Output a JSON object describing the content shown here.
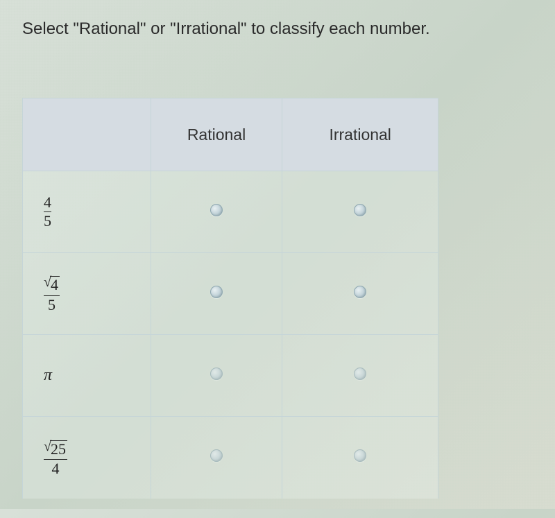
{
  "prompt": "Select \"Rational\" or \"Irrational\" to classify each number.",
  "headers": {
    "col1": "",
    "col2": "Rational",
    "col3": "Irrational"
  },
  "rows": [
    {
      "expression": {
        "type": "fraction",
        "num": "4",
        "den": "5"
      },
      "label": "4/5"
    },
    {
      "expression": {
        "type": "sqrt-fraction",
        "num_sqrt": "4",
        "den": "5"
      },
      "label": "sqrt(4)/5"
    },
    {
      "expression": {
        "type": "pi"
      },
      "label": "pi"
    },
    {
      "expression": {
        "type": "sqrt-fraction",
        "num_sqrt": "25",
        "den": "4"
      },
      "label": "sqrt(25)/4"
    }
  ]
}
